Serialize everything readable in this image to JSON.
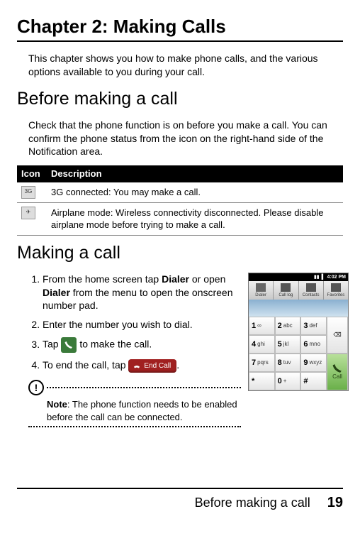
{
  "chapter_title": "Chapter 2: Making Calls",
  "intro": "This chapter shows you how to make phone calls, and the various options available to you during your call.",
  "section1_title": "Before making a call",
  "section1_body": "Check that the phone function is on before you make a call. You can confirm the phone status from the icon on the right-hand side of the Notification area.",
  "icon_table": {
    "head_icon": "Icon",
    "head_desc": "Description",
    "rows": [
      {
        "icon": "3G",
        "desc": "3G connected: You may make a call."
      },
      {
        "icon": "✈",
        "desc": "Airplane mode: Wireless connectivity disconnected. Please disable airplane mode before trying to make a call."
      }
    ]
  },
  "section2_title": "Making a call",
  "steps": {
    "s1a": "From the home screen tap ",
    "s1b": "Dialer",
    "s1c": " or open ",
    "s1d": "Dialer",
    "s1e": " from the menu to open the onscreen number pad.",
    "s2": "Enter the number you wish to dial.",
    "s3a": "Tap ",
    "s3b": " to make the call.",
    "s4a": "To end the call, tap ",
    "s4b": "End Call",
    "s4c": "."
  },
  "note_label": "Note",
  "note_text": ": The phone function needs to be enabled before the call can be connected.",
  "phone": {
    "time": "4:02 PM",
    "tabs": [
      "Dialer",
      "Call log",
      "Contacts",
      "Favorites"
    ],
    "keys": [
      {
        "n": "1",
        "l": "∞"
      },
      {
        "n": "2",
        "l": "abc"
      },
      {
        "n": "3",
        "l": "def"
      },
      {
        "n": "4",
        "l": "ghi"
      },
      {
        "n": "5",
        "l": "jkl"
      },
      {
        "n": "6",
        "l": "mno"
      },
      {
        "n": "7",
        "l": "pqrs"
      },
      {
        "n": "8",
        "l": "tuv"
      },
      {
        "n": "9",
        "l": "wxyz"
      },
      {
        "n": "*",
        "l": ""
      },
      {
        "n": "0",
        "l": "+"
      },
      {
        "n": "#",
        "l": ""
      }
    ],
    "backspace": "⌫",
    "call_label": "Call"
  },
  "footer_text": "Before making a call",
  "page_number": "19"
}
